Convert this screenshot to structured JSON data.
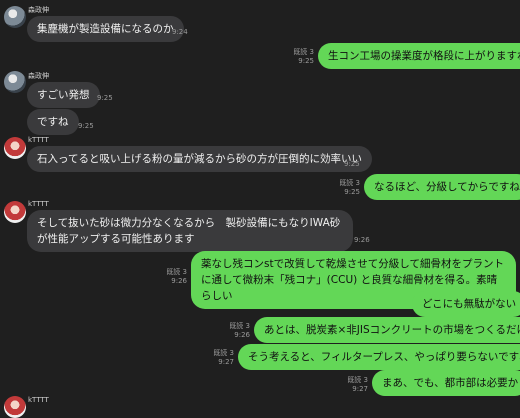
{
  "messages": [
    {
      "sender": "森政伸",
      "text": "集塵機が製造設備になるのか",
      "time": "9:24"
    },
    {
      "read": "既読 3",
      "time": "9:25",
      "text": "生コン工場の操業度が格段に上がりますね"
    },
    {
      "sender": "森政伸",
      "text": "すごい発想",
      "time": "9:25"
    },
    {
      "text": "ですね",
      "time": "9:25"
    },
    {
      "sender": "kTTTT",
      "text": "石入ってると吸い上げる粉の量が減るから砂の方が圧倒的に効率いい",
      "time": "9:25"
    },
    {
      "read": "既読 3",
      "time": "9:25",
      "text": "なるほど、分級してからですね"
    },
    {
      "sender": "kTTTT",
      "text": "そして抜いた砂は微力分なくなるから　製砂設備にもなりIWA砂が性能アップする可能性あります",
      "time": "9:26"
    },
    {
      "read": "既読 3",
      "time": "9:26",
      "text": "薬なし残コンstで改質して乾燥させて分級して細骨材をプラントに通して微粉末「残コナ」(CCU) と良質な細骨材を得る。素晴らしい"
    },
    {
      "text": "どこにも無駄がない"
    },
    {
      "read": "既読 3",
      "time": "9:26",
      "text": "あとは、脱炭素×非JISコンクリートの市場をつくるだけ"
    },
    {
      "read": "既読 3",
      "time": "9:27",
      "text": "そう考えると、フィルタープレス、やっぱり要らないですね"
    },
    {
      "read": "既読 3",
      "time": "9:27",
      "text": "まあ、でも、都市部は必要か"
    },
    {
      "sender": "kTTTT"
    }
  ]
}
